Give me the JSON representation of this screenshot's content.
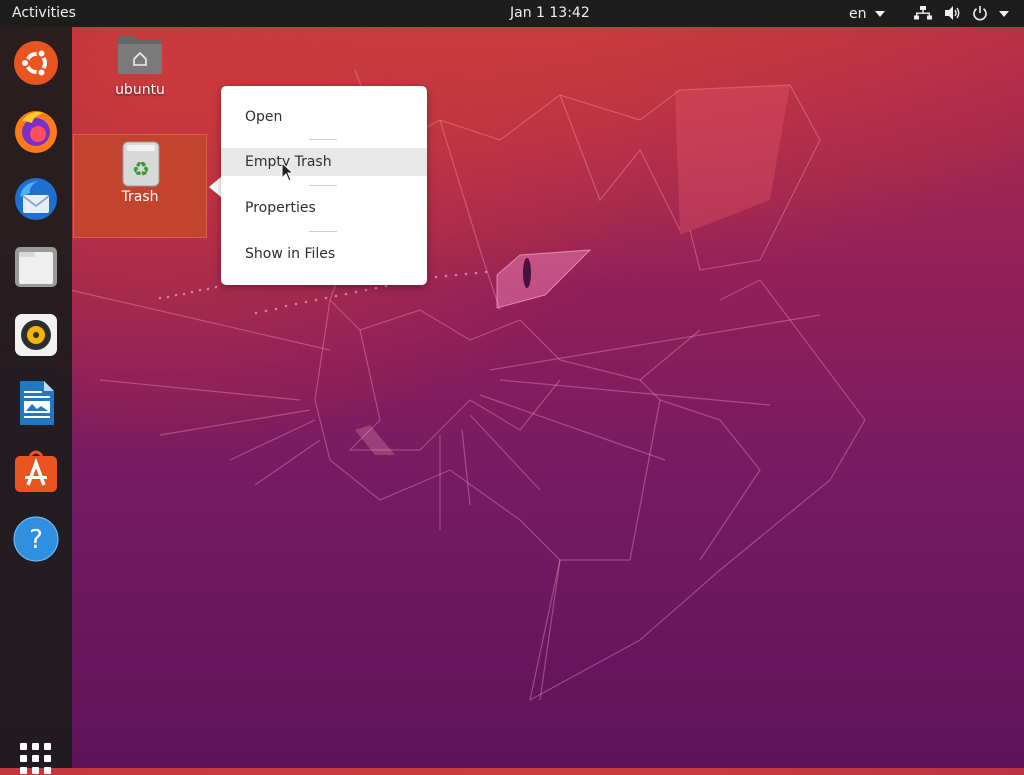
{
  "topbar": {
    "activities": "Activities",
    "clock": "Jan 1  13:42",
    "language": "en",
    "network_icon": "network-wired-icon",
    "volume_icon": "speaker-icon",
    "power_icon": "power-icon"
  },
  "dock": {
    "items": [
      {
        "name": "ubuntu-software-icon"
      },
      {
        "name": "firefox-icon"
      },
      {
        "name": "thunderbird-icon"
      },
      {
        "name": "files-icon"
      },
      {
        "name": "rhythmbox-icon"
      },
      {
        "name": "libreoffice-writer-icon"
      },
      {
        "name": "app-center-icon"
      },
      {
        "name": "help-icon"
      }
    ],
    "show_apps_icon": "apps-grid-icon"
  },
  "desktop": {
    "home_label": "ubuntu",
    "trash_label": "Trash"
  },
  "context_menu": {
    "items": [
      {
        "label": "Open"
      },
      {
        "label": "Empty Trash"
      },
      {
        "label": "Properties"
      },
      {
        "label": "Show in Files"
      }
    ],
    "hovered_index": 1
  },
  "colors": {
    "topbar": "#1d1d1d",
    "selection": "#c2432e",
    "wallpaper_top": "#b72f45",
    "wallpaper_bottom": "#5e1458"
  }
}
